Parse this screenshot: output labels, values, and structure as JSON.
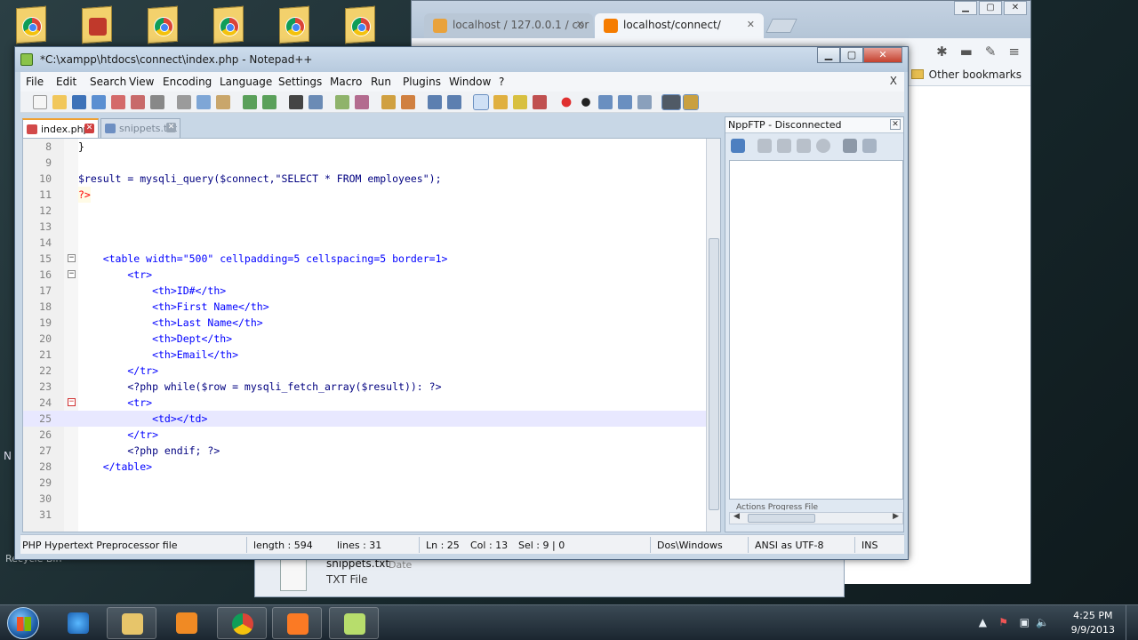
{
  "browser": {
    "tabs": [
      {
        "label": "localhost / 127.0.0.1 / cor",
        "active": false
      },
      {
        "label": "localhost/connect/",
        "active": true
      }
    ],
    "bookmark_other": "Other bookmarks"
  },
  "explorer": {
    "file_name": "snippets.txt",
    "date_label": "Date",
    "file_type": "TXT File"
  },
  "desktop": {
    "left_text": "N",
    "recycle_label": "Recycle Bin"
  },
  "notepad": {
    "title": "*C:\\xampp\\htdocs\\connect\\index.php - Notepad++",
    "close_x": "X",
    "menu": [
      "File",
      "Edit",
      "Search",
      "View",
      "Encoding",
      "Language",
      "Settings",
      "Macro",
      "Run",
      "Plugins",
      "Window",
      "?"
    ],
    "tabs": [
      {
        "label": "index.php",
        "active": true
      },
      {
        "label": "snippets.txt",
        "active": false
      }
    ],
    "lines": [
      {
        "num": "8",
        "text": "}"
      },
      {
        "num": "9",
        "text": ""
      },
      {
        "num": "10",
        "text": "$result = mysqli_query($connect,\"SELECT * FROM employees\");"
      },
      {
        "num": "11",
        "text": "?>"
      },
      {
        "num": "12",
        "text": ""
      },
      {
        "num": "13",
        "text": ""
      },
      {
        "num": "14",
        "text": ""
      },
      {
        "num": "15",
        "text": "    <table width=\"500\" cellpadding=5 cellspacing=5 border=1>"
      },
      {
        "num": "16",
        "text": "        <tr>"
      },
      {
        "num": "17",
        "text": "            <th>ID#</th>"
      },
      {
        "num": "18",
        "text": "            <th>First Name</th>"
      },
      {
        "num": "19",
        "text": "            <th>Last Name</th>"
      },
      {
        "num": "20",
        "text": "            <th>Dept</th>"
      },
      {
        "num": "21",
        "text": "            <th>Email</th>"
      },
      {
        "num": "22",
        "text": "        </tr>"
      },
      {
        "num": "23",
        "text": "        <?php while($row = mysqli_fetch_array($result)): ?>"
      },
      {
        "num": "24",
        "text": "        <tr>"
      },
      {
        "num": "25",
        "text": "            <td></td>"
      },
      {
        "num": "26",
        "text": "        </tr>"
      },
      {
        "num": "27",
        "text": "        <?php endif; ?>"
      },
      {
        "num": "28",
        "text": "    </table>"
      },
      {
        "num": "29",
        "text": ""
      },
      {
        "num": "30",
        "text": ""
      },
      {
        "num": "31",
        "text": ""
      }
    ],
    "status": {
      "filetype": "PHP Hypertext Preprocessor file",
      "length": "length : 594",
      "lines": "lines : 31",
      "ln": "Ln : 25",
      "col": "Col : 13",
      "sel": "Sel : 9 | 0",
      "eol": "Dos\\Windows",
      "encoding": "ANSI as UTF-8",
      "mode": "INS"
    },
    "ftp_title": "NppFTP - Disconnected",
    "ftp_lower_header": "Actions   Progress   File"
  },
  "taskbar": {
    "time": "4:25 PM",
    "date": "9/9/2013"
  },
  "colors": {
    "keyword": "#0000ff",
    "attribute": "#ff0000",
    "string": "#808080",
    "variable": "#000080"
  }
}
